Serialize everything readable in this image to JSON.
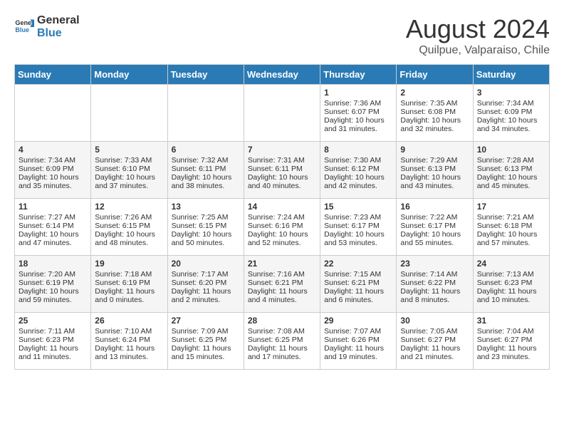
{
  "header": {
    "logo": {
      "general": "General",
      "blue": "Blue"
    },
    "title": "August 2024",
    "location": "Quilpue, Valparaiso, Chile"
  },
  "days_of_week": [
    "Sunday",
    "Monday",
    "Tuesday",
    "Wednesday",
    "Thursday",
    "Friday",
    "Saturday"
  ],
  "weeks": [
    [
      {
        "day": "",
        "content": ""
      },
      {
        "day": "",
        "content": ""
      },
      {
        "day": "",
        "content": ""
      },
      {
        "day": "",
        "content": ""
      },
      {
        "day": "1",
        "content": "Sunrise: 7:36 AM\nSunset: 6:07 PM\nDaylight: 10 hours and 31 minutes."
      },
      {
        "day": "2",
        "content": "Sunrise: 7:35 AM\nSunset: 6:08 PM\nDaylight: 10 hours and 32 minutes."
      },
      {
        "day": "3",
        "content": "Sunrise: 7:34 AM\nSunset: 6:09 PM\nDaylight: 10 hours and 34 minutes."
      }
    ],
    [
      {
        "day": "4",
        "content": "Sunrise: 7:34 AM\nSunset: 6:09 PM\nDaylight: 10 hours and 35 minutes."
      },
      {
        "day": "5",
        "content": "Sunrise: 7:33 AM\nSunset: 6:10 PM\nDaylight: 10 hours and 37 minutes."
      },
      {
        "day": "6",
        "content": "Sunrise: 7:32 AM\nSunset: 6:11 PM\nDaylight: 10 hours and 38 minutes."
      },
      {
        "day": "7",
        "content": "Sunrise: 7:31 AM\nSunset: 6:11 PM\nDaylight: 10 hours and 40 minutes."
      },
      {
        "day": "8",
        "content": "Sunrise: 7:30 AM\nSunset: 6:12 PM\nDaylight: 10 hours and 42 minutes."
      },
      {
        "day": "9",
        "content": "Sunrise: 7:29 AM\nSunset: 6:13 PM\nDaylight: 10 hours and 43 minutes."
      },
      {
        "day": "10",
        "content": "Sunrise: 7:28 AM\nSunset: 6:13 PM\nDaylight: 10 hours and 45 minutes."
      }
    ],
    [
      {
        "day": "11",
        "content": "Sunrise: 7:27 AM\nSunset: 6:14 PM\nDaylight: 10 hours and 47 minutes."
      },
      {
        "day": "12",
        "content": "Sunrise: 7:26 AM\nSunset: 6:15 PM\nDaylight: 10 hours and 48 minutes."
      },
      {
        "day": "13",
        "content": "Sunrise: 7:25 AM\nSunset: 6:15 PM\nDaylight: 10 hours and 50 minutes."
      },
      {
        "day": "14",
        "content": "Sunrise: 7:24 AM\nSunset: 6:16 PM\nDaylight: 10 hours and 52 minutes."
      },
      {
        "day": "15",
        "content": "Sunrise: 7:23 AM\nSunset: 6:17 PM\nDaylight: 10 hours and 53 minutes."
      },
      {
        "day": "16",
        "content": "Sunrise: 7:22 AM\nSunset: 6:17 PM\nDaylight: 10 hours and 55 minutes."
      },
      {
        "day": "17",
        "content": "Sunrise: 7:21 AM\nSunset: 6:18 PM\nDaylight: 10 hours and 57 minutes."
      }
    ],
    [
      {
        "day": "18",
        "content": "Sunrise: 7:20 AM\nSunset: 6:19 PM\nDaylight: 10 hours and 59 minutes."
      },
      {
        "day": "19",
        "content": "Sunrise: 7:18 AM\nSunset: 6:19 PM\nDaylight: 11 hours and 0 minutes."
      },
      {
        "day": "20",
        "content": "Sunrise: 7:17 AM\nSunset: 6:20 PM\nDaylight: 11 hours and 2 minutes."
      },
      {
        "day": "21",
        "content": "Sunrise: 7:16 AM\nSunset: 6:21 PM\nDaylight: 11 hours and 4 minutes."
      },
      {
        "day": "22",
        "content": "Sunrise: 7:15 AM\nSunset: 6:21 PM\nDaylight: 11 hours and 6 minutes."
      },
      {
        "day": "23",
        "content": "Sunrise: 7:14 AM\nSunset: 6:22 PM\nDaylight: 11 hours and 8 minutes."
      },
      {
        "day": "24",
        "content": "Sunrise: 7:13 AM\nSunset: 6:23 PM\nDaylight: 11 hours and 10 minutes."
      }
    ],
    [
      {
        "day": "25",
        "content": "Sunrise: 7:11 AM\nSunset: 6:23 PM\nDaylight: 11 hours and 11 minutes."
      },
      {
        "day": "26",
        "content": "Sunrise: 7:10 AM\nSunset: 6:24 PM\nDaylight: 11 hours and 13 minutes."
      },
      {
        "day": "27",
        "content": "Sunrise: 7:09 AM\nSunset: 6:25 PM\nDaylight: 11 hours and 15 minutes."
      },
      {
        "day": "28",
        "content": "Sunrise: 7:08 AM\nSunset: 6:25 PM\nDaylight: 11 hours and 17 minutes."
      },
      {
        "day": "29",
        "content": "Sunrise: 7:07 AM\nSunset: 6:26 PM\nDaylight: 11 hours and 19 minutes."
      },
      {
        "day": "30",
        "content": "Sunrise: 7:05 AM\nSunset: 6:27 PM\nDaylight: 11 hours and 21 minutes."
      },
      {
        "day": "31",
        "content": "Sunrise: 7:04 AM\nSunset: 6:27 PM\nDaylight: 11 hours and 23 minutes."
      }
    ]
  ]
}
